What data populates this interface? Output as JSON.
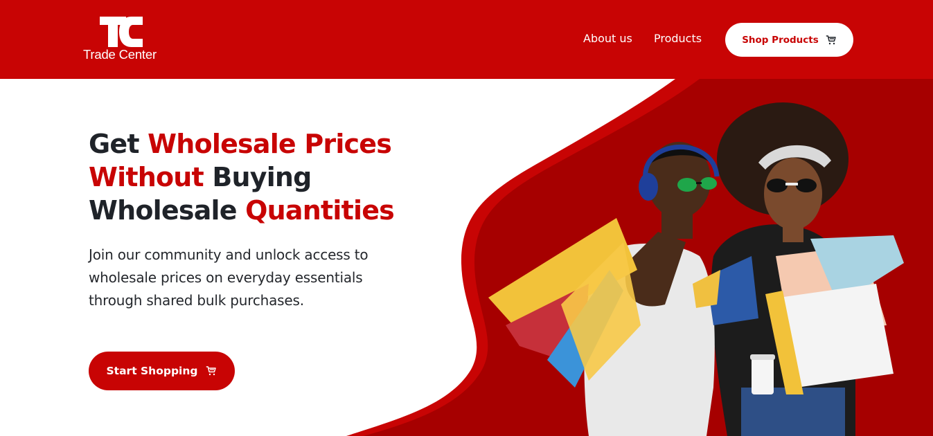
{
  "brand": {
    "name": "Trade Center",
    "accent": "#c80404",
    "dark_red": "#a80000"
  },
  "nav": {
    "about": "About us",
    "products": "Products",
    "shop_button": "Shop Products",
    "shop_icon": "cart-icon"
  },
  "hero": {
    "headline": {
      "part1": "Get ",
      "part2": "Wholesale Prices",
      "part3": "Without",
      "part4": " Buying",
      "part5": "Wholesale ",
      "part6": "Quantities"
    },
    "subtext": "Join our community and unlock access to wholesale prices on everyday essentials through shared bulk purchases.",
    "cta": "Start Shopping",
    "cta_icon": "cart-icon"
  }
}
